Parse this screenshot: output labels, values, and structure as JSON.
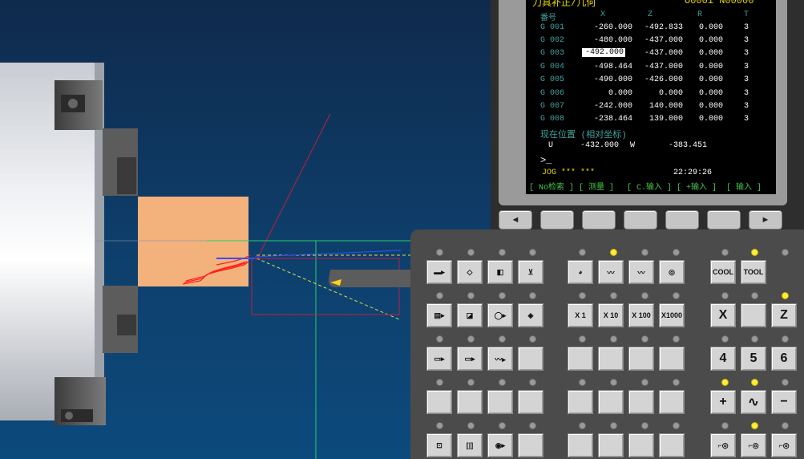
{
  "screen": {
    "title_cut": "刀具补正/几何",
    "prog_cut": "O0001  N00000",
    "columns": [
      "番号",
      "X",
      "Z",
      "R",
      "T"
    ],
    "rows": [
      {
        "no": "G 001",
        "x": "-260.000",
        "z": "-492.833",
        "r": "0.000",
        "t": "3"
      },
      {
        "no": "G 002",
        "x": "-480.000",
        "z": "-437.000",
        "r": "0.000",
        "t": "3"
      },
      {
        "no": "G 003",
        "x": "-492.000",
        "z": "-437.000",
        "r": "0.000",
        "t": "3"
      },
      {
        "no": "G 004",
        "x": "-498.464",
        "z": "-437.000",
        "r": "0.000",
        "t": "3"
      },
      {
        "no": "G 005",
        "x": "-490.000",
        "z": "-426.000",
        "r": "0.000",
        "t": "3"
      },
      {
        "no": "G 006",
        "x": "0.000",
        "z": "0.000",
        "r": "0.000",
        "t": "3"
      },
      {
        "no": "G 007",
        "x": "-242.000",
        "z": "140.000",
        "r": "0.000",
        "t": "3"
      },
      {
        "no": "G 008",
        "x": "-238.464",
        "z": "139.000",
        "r": "0.000",
        "t": "3"
      }
    ],
    "position_label": "现在位置 (相对坐标)",
    "u_label": "U",
    "u_value": "-432.000",
    "w_label": "W",
    "w_value": "-383.451",
    "prompt": ">_",
    "mode": "JOG *** ***",
    "time": "22:29:26",
    "softkeys": [
      "[ No检索 ]",
      "[  测量  ]",
      "[ C.输入 ]",
      "[ +输入 ]",
      "[  输入  ]"
    ]
  },
  "panel": {
    "nav_left": "◄",
    "nav_right": "►",
    "labels": {
      "cool": "COOL",
      "tool": "TOOL",
      "x1": "X   1",
      "x10": "X  10",
      "x100": "X 100",
      "x1000": "X1000",
      "axis_x": "X",
      "axis_z": "Z",
      "k4": "4",
      "k5": "5",
      "k6": "6",
      "plus": "+",
      "rapid": "∿",
      "minus": "−"
    }
  }
}
